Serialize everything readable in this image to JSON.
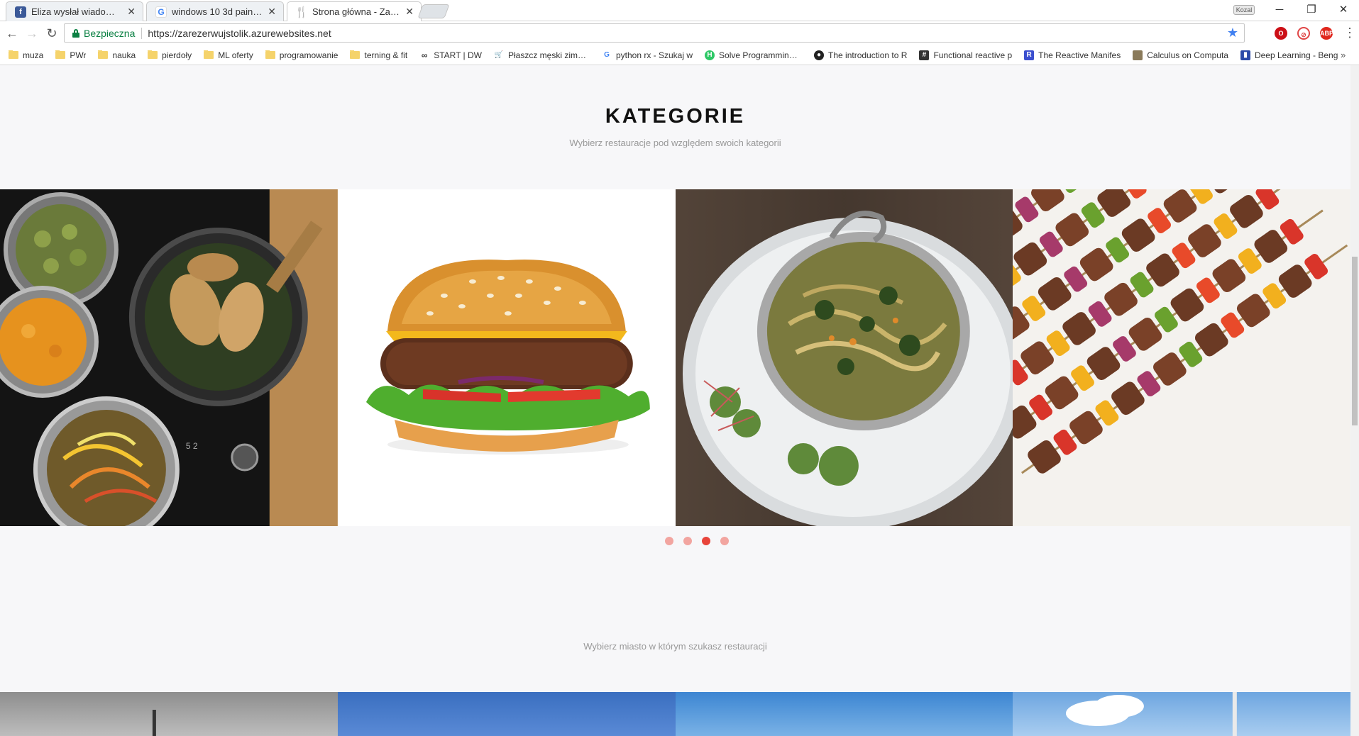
{
  "browser": {
    "tabs": [
      {
        "title": "Eliza wysłał wiadomość d",
        "favicon": "facebook-icon"
      },
      {
        "title": "windows 10 3d paint zaz",
        "favicon": "google-icon"
      },
      {
        "title": "Strona główna - Zarezer",
        "favicon": "fork-knife-icon",
        "active": true
      }
    ],
    "profile": "Kozal",
    "security_label": "Bezpieczna",
    "url": "https://zarezerwujstolik.azurewebsites.net",
    "bookmarks": [
      {
        "label": "muza",
        "icon": "folder-icon"
      },
      {
        "label": "PWr",
        "icon": "folder-icon"
      },
      {
        "label": "nauka",
        "icon": "folder-icon"
      },
      {
        "label": "pierdoły",
        "icon": "folder-icon"
      },
      {
        "label": "ML oferty",
        "icon": "folder-icon"
      },
      {
        "label": "programowanie",
        "icon": "folder-icon"
      },
      {
        "label": "terning & fit",
        "icon": "folder-icon"
      },
      {
        "label": "START | DW",
        "icon": "link-icon"
      },
      {
        "label": "Płaszcz męski zimowy",
        "icon": "cart-icon"
      },
      {
        "label": "python rx - Szukaj w",
        "icon": "google-icon"
      },
      {
        "label": "Solve Programming C",
        "icon": "h-icon"
      },
      {
        "label": "The introduction to R",
        "icon": "github-icon"
      },
      {
        "label": "Functional reactive p",
        "icon": "hash-icon"
      },
      {
        "label": "The Reactive Manifes",
        "icon": "r-icon"
      },
      {
        "label": "Calculus on Computa",
        "icon": "image-icon"
      },
      {
        "label": "Deep Learning - Beng",
        "icon": "book-icon"
      }
    ],
    "bookmarks_more": "»"
  },
  "page": {
    "categories_title": "KATEGORIE",
    "categories_subtitle": "Wybierz restauracje pod względem swoich kategorii",
    "slides": [
      "stir-fry-pans-image",
      "burger-image",
      "noodle-bowl-image",
      "kebab-skewers-image"
    ],
    "dots_count": 4,
    "active_dot": 3,
    "city_subtitle": "Wybierz miasto w którym szukasz restauracji"
  },
  "colors": {
    "accent": "#e8443a",
    "dot_inactive": "#f2a5a0",
    "secure_green": "#0b8043"
  }
}
